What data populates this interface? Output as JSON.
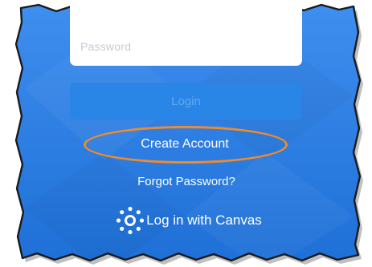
{
  "colors": {
    "background_top": "#3f8ff0",
    "background_bottom": "#1e6fd6",
    "login_button": "#2a86e6",
    "login_text": "#61a8f0",
    "highlight_ring": "#f08a2a",
    "placeholder": "#c4cad3"
  },
  "form": {
    "password_placeholder": "Password",
    "login_label": "Login"
  },
  "links": {
    "create_account": "Create Account",
    "forgot_password": "Forgot Password?",
    "canvas_login": "Log in with Canvas"
  },
  "icons": {
    "canvas": "canvas-logo-icon"
  }
}
